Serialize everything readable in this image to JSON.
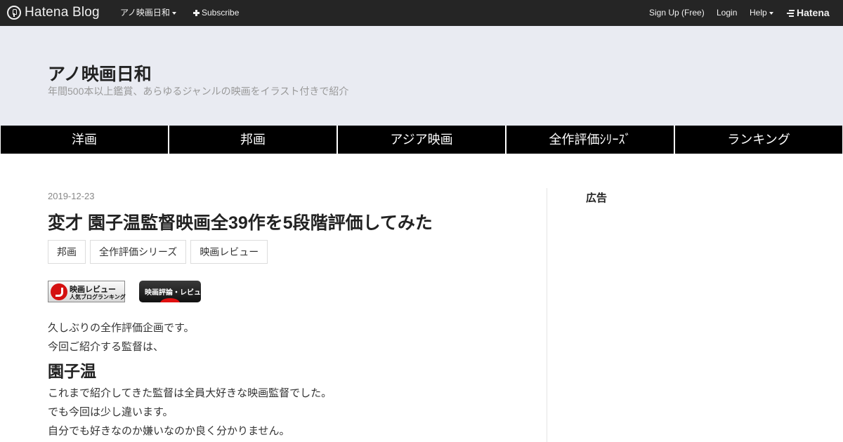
{
  "topbar": {
    "brand": "Hatena Blog",
    "blog_menu": "アノ映画日和",
    "subscribe": "Subscribe",
    "signup": "Sign Up (Free)",
    "login": "Login",
    "help": "Help",
    "hatena": "Hatena"
  },
  "header": {
    "title": "アノ映画日和",
    "description": "年間500本以上鑑賞、あらゆるジャンルの映画をイラスト付きで紹介"
  },
  "nav": [
    "洋画",
    "邦画",
    "アジア映画",
    "全作評価ｼﾘｰｽﾞ",
    "ランキング"
  ],
  "entry": {
    "date": "2019-12-23",
    "title": "変才 園子温監督映画全39作を5段階評価してみた",
    "tags": [
      "邦画",
      "全作評価シリーズ",
      "映画レビュー"
    ],
    "banner1": {
      "line1": "映画レビュー",
      "line2": "人気ブログランキング"
    },
    "banner2": "映画評論・レビュー",
    "paragraphs": [
      "久しぶりの全作評価企画です。",
      "今回ご紹介する監督は、"
    ],
    "director": "園子温",
    "paragraphs2": [
      "これまで紹介してきた監督は全員大好きな映画監督でした。",
      "でも今回は少し違います。",
      "自分でも好きなのか嫌いなのか良く分かりません。"
    ]
  },
  "sidebar": {
    "ad_title": "広告"
  },
  "colors": {
    "topbar": "#252525",
    "header_bg": "#e9ebf2",
    "nav_bg": "#000000",
    "accent_red": "#d41010"
  }
}
